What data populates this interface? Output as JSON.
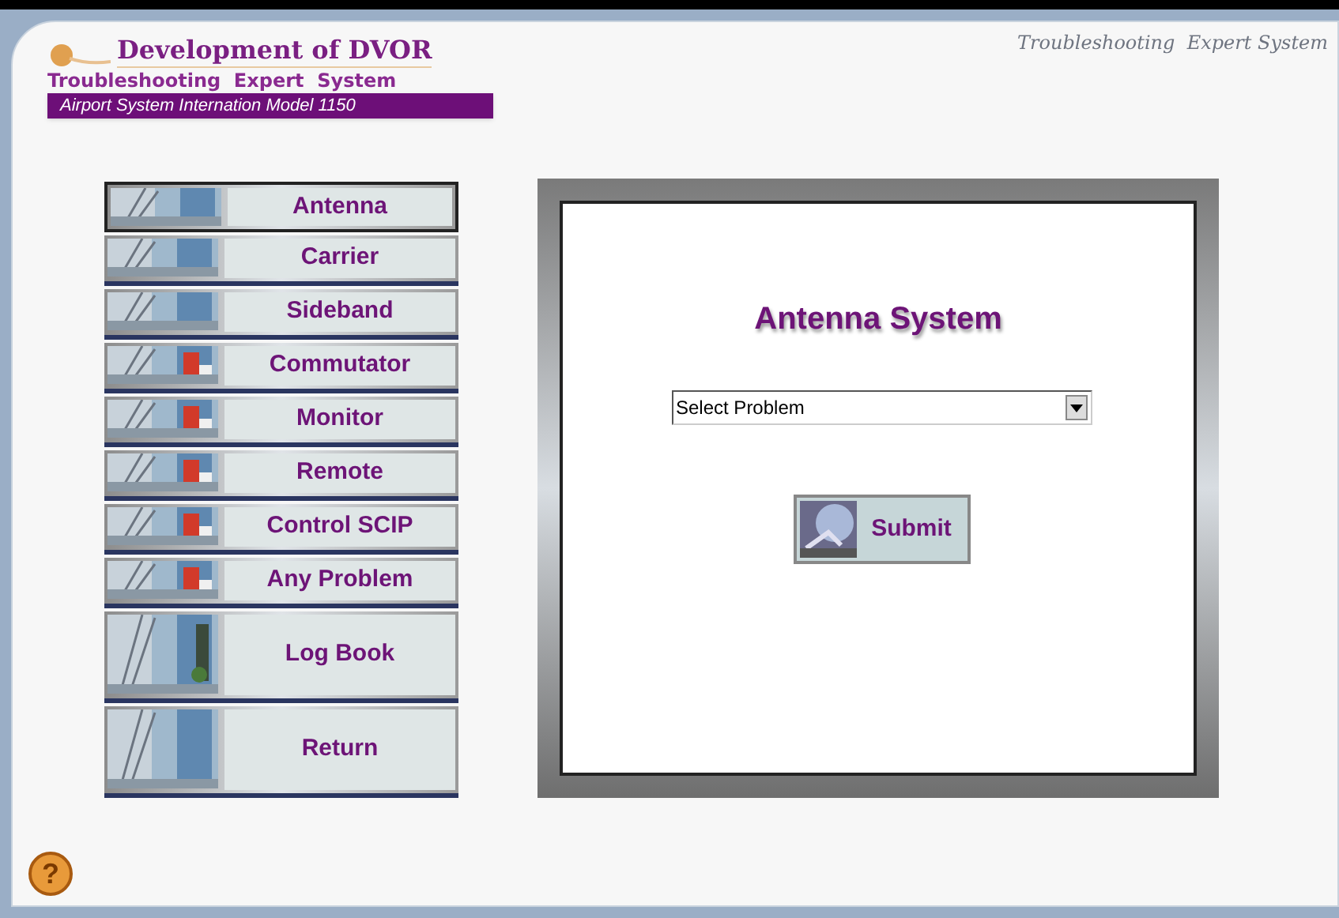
{
  "header": {
    "title": "Development of DVOR",
    "subtitle": "Troubleshooting  Expert  System",
    "model": "Airport System Internation Model 1150"
  },
  "top_right_title": "Troubleshooting  Expert System",
  "menu": [
    {
      "label": "Antenna",
      "selected": true,
      "kind": "small"
    },
    {
      "label": "Carrier",
      "selected": false,
      "kind": "small"
    },
    {
      "label": "Sideband",
      "selected": false,
      "kind": "small"
    },
    {
      "label": "Commutator",
      "selected": false,
      "kind": "small"
    },
    {
      "label": "Monitor",
      "selected": false,
      "kind": "small"
    },
    {
      "label": "Remote",
      "selected": false,
      "kind": "small"
    },
    {
      "label": "Control SCIP",
      "selected": false,
      "kind": "small"
    },
    {
      "label": "Any Problem",
      "selected": false,
      "kind": "small"
    },
    {
      "label": "Log Book",
      "selected": false,
      "kind": "large"
    },
    {
      "label": "Return",
      "selected": false,
      "kind": "large"
    }
  ],
  "panel": {
    "title": "Antenna System",
    "problem_select": {
      "value": "Select Problem"
    },
    "submit": "Submit"
  },
  "help_button": {
    "label": "?"
  }
}
